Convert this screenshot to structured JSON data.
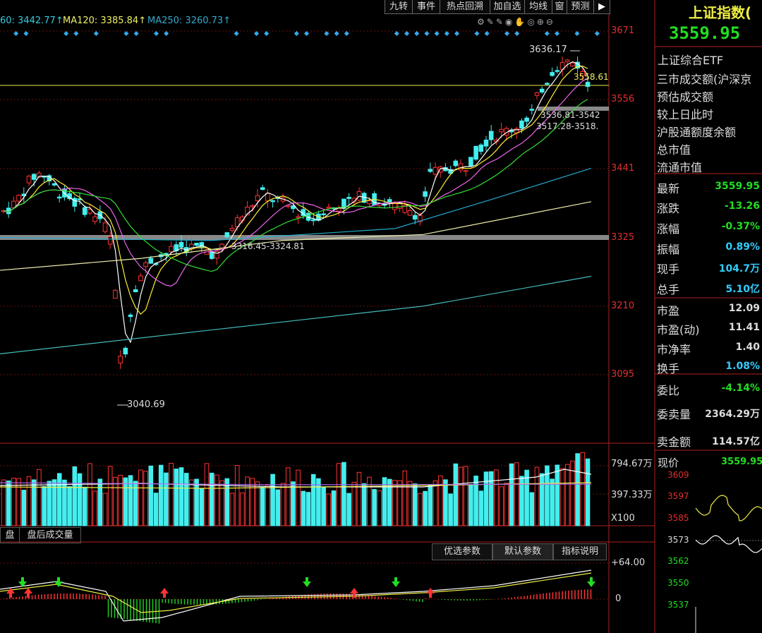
{
  "toolbar": {
    "items": [
      "九转",
      "事件",
      "热点回溯",
      "加自选",
      "均线",
      "窗",
      "预测"
    ],
    "right_arrow": "▶"
  },
  "ma_legend": {
    "ma60": "60: 3442.77↑",
    "ma120": "MA120: 3385.84↑",
    "ma250": "MA250: 3260.73↑"
  },
  "annotations": {
    "high": "3636.17",
    "low": "3040.69",
    "last_label": "3558.61",
    "band1": "3536.81-3542",
    "band2": "3517.28-3518.",
    "band3": "3316.45-3324.81"
  },
  "price_axis": [
    "3671",
    "3556",
    "3441",
    "3325",
    "3210",
    "3095"
  ],
  "volume_axis": {
    "top": "794.67万",
    "mid": "397.33万",
    "unit": "X100"
  },
  "macd_axis": {
    "top": "+64.00",
    "zero": "0"
  },
  "bottom_tabs": [
    "盘",
    "盘后成交量"
  ],
  "indicator_buttons": [
    "优选参数",
    "默认参数",
    "指标说明"
  ],
  "right_panel": {
    "title": "上证指数(",
    "price": "3559.95",
    "etf": "上证综合ETF",
    "info_rows": [
      "三市成交额(沪深京",
      "预估成交额",
      "较上日此时",
      "沪股通额度余额",
      "总市值",
      "流通市值"
    ],
    "stats": [
      {
        "k": "最新",
        "v": "3559.95",
        "c": "#22dd22"
      },
      {
        "k": "涨跌",
        "v": "-13.26",
        "c": "#22dd22"
      },
      {
        "k": "涨幅",
        "v": "-0.37%",
        "c": "#22dd22"
      },
      {
        "k": "振幅",
        "v": "0.89%",
        "c": "#33ccff"
      },
      {
        "k": "现手",
        "v": "104.7万",
        "c": "#33ccff"
      },
      {
        "k": "总手",
        "v": "5.10亿",
        "c": "#33ccff"
      },
      {
        "k": "市盈",
        "v": "12.09",
        "c": "#dddddd"
      },
      {
        "k": "市盈(动)",
        "v": "11.41",
        "c": "#dddddd"
      },
      {
        "k": "市净率",
        "v": "1.40",
        "c": "#dddddd"
      },
      {
        "k": "换手",
        "v": "1.08%",
        "c": "#33ccff"
      },
      {
        "k": "委比",
        "v": "-4.14%",
        "c": "#22dd22"
      },
      {
        "k": "委卖量",
        "v": "2364.29万",
        "c": "#dddddd"
      },
      {
        "k": "卖金额",
        "v": "114.57亿",
        "c": "#dddddd"
      }
    ],
    "mini": {
      "label": "现价",
      "value": "3559.95",
      "axis": [
        "3609",
        "3597",
        "3585",
        "3573",
        "3562",
        "3550",
        "3537"
      ]
    }
  },
  "chart_data": {
    "type": "candlestick",
    "price_axis_ticks": [
      3671,
      3556,
      3441,
      3325,
      3210,
      3095
    ],
    "high": 3636.17,
    "low": 3040.69,
    "last": 3559.95,
    "moving_averages": {
      "MA60": 3442.77,
      "MA120": 3385.84,
      "MA250": 3260.73
    },
    "volume_axis_ticks": [
      794.67,
      397.33
    ]
  },
  "colors": {
    "up": "#ff3333",
    "down": "#44eeee",
    "ma5": "#ffffff",
    "ma10": "#ffee33",
    "ma20": "#ee66ee",
    "ma30": "#33dd33",
    "ma60": "#22aacc",
    "ma120": "#eeeeaa",
    "ma250": "#44bbbb"
  }
}
